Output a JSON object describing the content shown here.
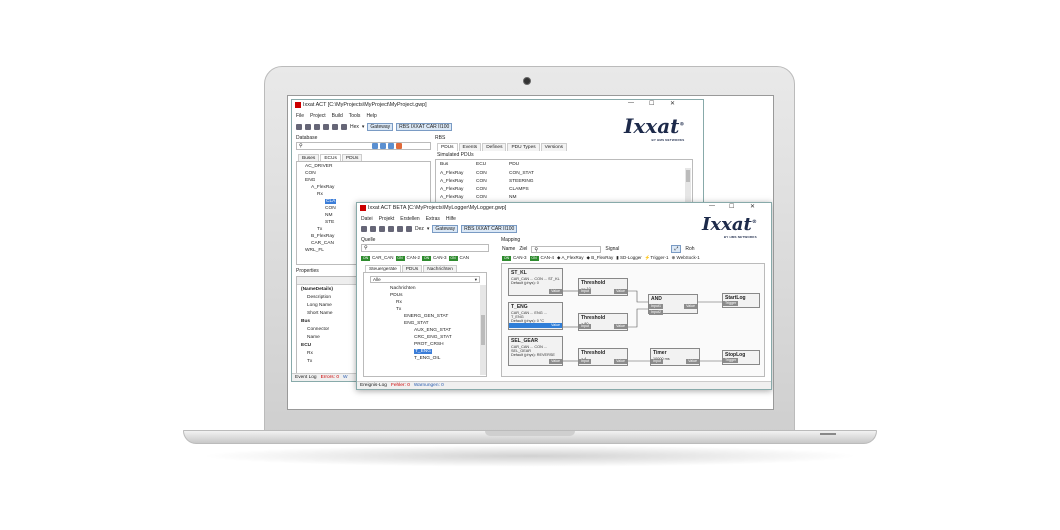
{
  "back_window": {
    "title": "Ixxat ACT [C:\\MyProjects\\MyProject\\MyProject.gwp]",
    "menu": [
      "File",
      "Project",
      "Build",
      "Tools",
      "Help"
    ],
    "toolbar": {
      "hex": "Hex",
      "gateway": "Gateway",
      "rbs_product": "RBS IXXAT CAR II100"
    },
    "database_label": "Database",
    "ecus_tabs": [
      "Buses",
      "ECUs",
      "PDUs"
    ],
    "tree": [
      "AC_DRIVER",
      "CON",
      "ENG",
      "A_FlexRay",
      "Rx",
      "CLA",
      "CON",
      "NM",
      "STE",
      "Tx",
      "B_FlexRay",
      "CAR_CAN",
      "WRL_FL"
    ],
    "properties": {
      "label": "Properties",
      "rows": [
        "(NameDetails)",
        "Description",
        "Long Name",
        "Short Name",
        "Bus",
        "Connector",
        "Name",
        "ECU",
        "Rx",
        "Tx"
      ]
    },
    "rbs_label": "RBS",
    "rbs_tabs": [
      "PDUs",
      "Events",
      "Defines",
      "PDU Types",
      "Versions"
    ],
    "simulated_label": "Simulated PDUs",
    "table": {
      "headers": [
        "Bus",
        "ECU",
        "PDU"
      ],
      "rows": [
        [
          "A_FlexRay",
          "CON",
          "CON_STAT"
        ],
        [
          "A_FlexRay",
          "CON",
          "STEERING"
        ],
        [
          "A_FlexRay",
          "CON",
          "CLAMPS"
        ],
        [
          "A_FlexRay",
          "CON",
          "NM"
        ]
      ]
    },
    "status": {
      "event_log": "Event Log",
      "errors": "Errors: 0",
      "warnings": "W"
    }
  },
  "front_window": {
    "title": "Ixxat ACT BETA [C:\\MyProjects\\MyLogger\\MyLogger.gwp]",
    "menu": [
      "Datei",
      "Projekt",
      "Erstellen",
      "Extras",
      "Hilfe"
    ],
    "toolbar": {
      "dez": "Dez",
      "gateway": "Gateway",
      "rbs_product": "RBS IXXAT CAR II100"
    },
    "quelle": {
      "label": "Quelle",
      "tabs": [
        "CAR_CAN",
        "CAN-2",
        "CAN-3",
        "CAN"
      ],
      "subtabs": [
        "Steuergeräte",
        "PDUs",
        "Nachrichten"
      ],
      "filter": "Alle",
      "tree": [
        "Nachrichten",
        "PDUs",
        "Rx",
        "Tx",
        "ENERG_GEN_STAT",
        "ENG_STAT",
        "AUX_ENG_STAT",
        "CRC_ENG_STAT",
        "PROT_CRSH",
        "T_ENG",
        "T_ENG_OIL"
      ]
    },
    "mapping": {
      "label": "Mapping",
      "toolbar": {
        "name": "Name",
        "ziel": "Ziel",
        "signal": "Signal",
        "roh": "Roh"
      },
      "tabs": [
        "CAN-3",
        "CAN-4",
        "A_FlexRay",
        "B_FlexRay",
        "SD-Logger",
        "Trigger-1",
        "WebSock-1"
      ],
      "nodes": {
        "st_kl": {
          "title": "ST_KL",
          "line1": "CAR_CAN ... CON ... ST_KL",
          "line2": "Default (phys): 0",
          "port": "Value"
        },
        "t_eng": {
          "title": "T_ENG",
          "line1": "CAR_CAN ... ENG ... T_ENG",
          "line2": "Default (phys): 0 °C",
          "port": "Value"
        },
        "sel_gear": {
          "title": "SEL_GEAR",
          "line1": "CAR_CAN ... CON ... SEL_GEAR",
          "line2": "Default (phys): REVERSE",
          "port": "Value"
        },
        "th1": {
          "title": "Threshold",
          "value": "== 10",
          "in": "Input",
          "out": "Value"
        },
        "th2": {
          "title": "Threshold",
          "value": "> 80",
          "in": "Input",
          "out": "Value"
        },
        "th3": {
          "title": "Threshold",
          "value": "> 4",
          "in": "Input",
          "out": "Value"
        },
        "and": {
          "title": "AND",
          "in1": "Input1",
          "in2": "Input2",
          "out": "Value"
        },
        "timer": {
          "title": "Timer",
          "value": "10000 ms",
          "in": "Input",
          "out": "Value"
        },
        "start": {
          "title": "StartLog",
          "in": "Trigger"
        },
        "stop": {
          "title": "StopLog",
          "in": "Trigger"
        }
      }
    },
    "status": {
      "log": "Ereignis-Log",
      "errors": "Fehler: 0",
      "warnings": "Warnungen: 0"
    }
  },
  "logo": {
    "brand": "Ixxat",
    "tagline": "BY HMS NETWORKS"
  }
}
